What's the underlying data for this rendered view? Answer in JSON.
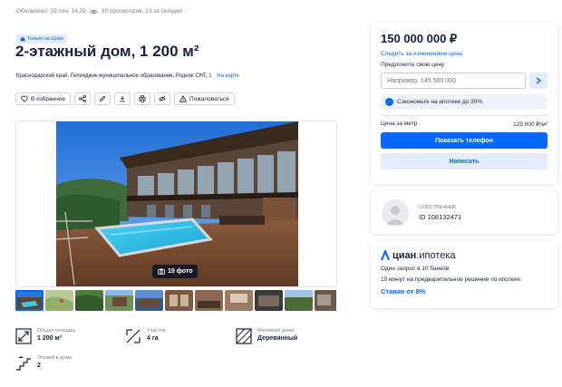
{
  "meta": {
    "updated": "Обновлено: 29 сен, 14:25",
    "views": "30 просмотров, 13 за сегодня"
  },
  "badge": "Только на Циан",
  "title": "2-этажный дом, 1 200 м²",
  "address": {
    "text": "Краснодарский край, Геленджик муниципальное образование, Родник СНТ, 1",
    "map_link": "На карте"
  },
  "actions": {
    "favorite": "В избранное",
    "complain": "Пожаловаться"
  },
  "gallery": {
    "photo_count": "19 фото"
  },
  "facts": [
    {
      "label": "Общая площадь",
      "value": "1 200 м²",
      "icon": "area-icon"
    },
    {
      "label": "Участок",
      "value": "4 га",
      "icon": "plot-icon"
    },
    {
      "label": "Материал дома",
      "value": "Деревянный",
      "icon": "material-icon"
    },
    {
      "label": "Этажей в доме",
      "value": "2",
      "icon": "stairs-icon"
    }
  ],
  "price_card": {
    "price": "150 000 000 ₽",
    "follow": "Следить за изменением цены",
    "offer_label": "Предложите свою цену",
    "offer_placeholder": "Например, 145 500 000",
    "mortgage_save": "Сэкономьте на ипотеке до 30%",
    "price_per_meter_label": "Цена за метр",
    "price_per_meter_value": "125 000 ₽/м²",
    "show_phone": "Показать телефон",
    "write": "Написать"
  },
  "owner": {
    "role": "СОБСТВЕННИК",
    "id": "ID 108132471"
  },
  "ipoteka": {
    "logo_bold": "циан",
    "logo_light": ".ипотека",
    "line1": "Один запрос в 10 банков",
    "line2": "10 минут на предварительное решение по ипотеке",
    "rate": "Ставки от 8%"
  },
  "colors": {
    "accent": "#0468ff",
    "text": "#152242",
    "muted": "#7a7f8c"
  }
}
